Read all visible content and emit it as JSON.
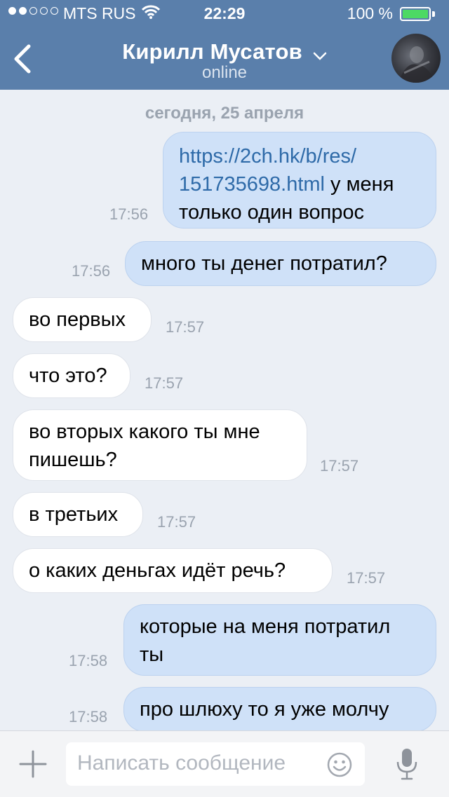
{
  "status_bar": {
    "carrier": "MTS RUS",
    "time": "22:29",
    "battery": "100 %"
  },
  "header": {
    "title": "Кирилл Мусатов",
    "status": "online"
  },
  "chat": {
    "date_separator": "сегодня, 25 апреля",
    "messages": [
      {
        "link_1": "https://2ch.hk/b/res/",
        "link_2": "151735698.html",
        "after_link": " у меня",
        "line_3": "только один вопрос",
        "time": "17:56"
      },
      {
        "text": "много ты денег потратил?",
        "time": "17:56"
      },
      {
        "text": "во первых",
        "time": "17:57"
      },
      {
        "text": "что это?",
        "time": "17:57"
      },
      {
        "line_1": "во вторых какого ты мне",
        "line_2": "пишешь?",
        "time": "17:57"
      },
      {
        "text": "в третьих",
        "time": "17:57"
      },
      {
        "text": "о каких деньгах идёт речь?",
        "time": "17:57"
      },
      {
        "line_1": "которые на меня потратил",
        "line_2": "ты",
        "time": "17:58"
      },
      {
        "text": "про шлюху то я уже молчу",
        "time": "17:58"
      }
    ]
  },
  "composer": {
    "placeholder": "Написать сообщение"
  }
}
